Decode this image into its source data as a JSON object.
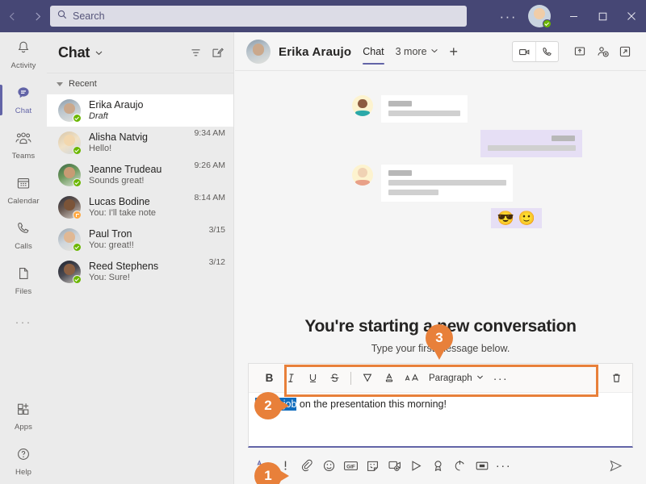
{
  "titlebar": {
    "back_icon": "chevron-left-icon",
    "forward_icon": "chevron-right-icon",
    "search_placeholder": "Search",
    "search_value": "",
    "settings_ellipsis": "···",
    "minimize_label": "—",
    "maximize_label": "☐",
    "close_label": "✕"
  },
  "rail": {
    "items": [
      {
        "label": "Activity",
        "icon": "bell-icon",
        "active": false
      },
      {
        "label": "Chat",
        "icon": "chat-bubble-icon",
        "active": true
      },
      {
        "label": "Teams",
        "icon": "people-icon",
        "active": false
      },
      {
        "label": "Calendar",
        "icon": "calendar-icon",
        "active": false
      },
      {
        "label": "Calls",
        "icon": "phone-icon",
        "active": false
      },
      {
        "label": "Files",
        "icon": "file-icon",
        "active": false
      }
    ],
    "more_label": "···",
    "bottom": [
      {
        "label": "Apps",
        "icon": "apps-grid-icon"
      },
      {
        "label": "Help",
        "icon": "question-circle-icon"
      }
    ]
  },
  "chatlist": {
    "title": "Chat",
    "caret_icon": "chevron-down-icon",
    "filter_icon": "filter-icon",
    "compose_icon": "new-chat-icon",
    "section_label": "Recent",
    "items": [
      {
        "name": "Erika Araujo",
        "preview": "Draft",
        "time": "",
        "selected": true,
        "draft": true,
        "presence": "available",
        "face": "f1"
      },
      {
        "name": "Alisha Natvig",
        "preview": "Hello!",
        "time": "9:34 AM",
        "selected": false,
        "draft": false,
        "presence": "available",
        "face": "f2"
      },
      {
        "name": "Jeanne Trudeau",
        "preview": "Sounds great!",
        "time": "9:26 AM",
        "selected": false,
        "draft": false,
        "presence": "available",
        "face": "f3"
      },
      {
        "name": "Lucas Bodine",
        "preview": "You: I'll take note",
        "time": "8:14 AM",
        "selected": false,
        "draft": false,
        "presence": "away",
        "face": "f4"
      },
      {
        "name": "Paul Tron",
        "preview": "You: great!!",
        "time": "3/15",
        "selected": false,
        "draft": false,
        "presence": "available",
        "face": "f5"
      },
      {
        "name": "Reed Stephens",
        "preview": "You: Sure!",
        "time": "3/12",
        "selected": false,
        "draft": false,
        "presence": "available",
        "face": "f6"
      }
    ]
  },
  "chat_header": {
    "contact_name": "Erika Araujo",
    "tabs": [
      {
        "label": "Chat",
        "active": true
      }
    ],
    "more_tabs_label": "3 more",
    "more_caret_icon": "chevron-down-icon",
    "add_tab_label": "+",
    "actions": [
      {
        "name": "video-call-icon"
      },
      {
        "name": "audio-call-icon"
      },
      {
        "name": "share-screen-icon"
      },
      {
        "name": "add-people-icon"
      },
      {
        "name": "popout-icon"
      }
    ]
  },
  "conversation": {
    "empty_title": "You're starting a new conversation",
    "empty_subtitle": "Type your first message below.",
    "reaction_emojis": [
      "😎",
      "🙂"
    ]
  },
  "compose": {
    "format_buttons": [
      {
        "name": "bold-button",
        "label": "B"
      },
      {
        "name": "italic-button",
        "label": "I"
      },
      {
        "name": "underline-button",
        "label": "U"
      },
      {
        "name": "strikethrough-button",
        "label": "S"
      },
      {
        "name": "highlight-color-button",
        "label": ""
      },
      {
        "name": "font-color-button",
        "label": "A"
      },
      {
        "name": "font-size-button",
        "label": "AA"
      }
    ],
    "paragraph_label": "Paragraph",
    "paragraph_caret_icon": "chevron-down-icon",
    "more_format_label": "···",
    "discard_icon": "trash-icon",
    "message_selected_text": "Great job",
    "message_rest_text": " on the presentation this morning!"
  },
  "action_bar": {
    "buttons": [
      {
        "name": "format-button",
        "accent": true
      },
      {
        "name": "importance-button",
        "accent": false
      },
      {
        "name": "attach-file-button",
        "accent": false
      },
      {
        "name": "emoji-button",
        "accent": false
      },
      {
        "name": "giphy-button",
        "accent": false
      },
      {
        "name": "sticker-button",
        "accent": false
      },
      {
        "name": "meet-now-button",
        "accent": false
      },
      {
        "name": "stream-button",
        "accent": false
      },
      {
        "name": "praise-button",
        "accent": false
      },
      {
        "name": "loop-button",
        "accent": false
      },
      {
        "name": "video-clip-button",
        "accent": false
      }
    ],
    "more_label": "···",
    "send_icon": "send-icon"
  },
  "callouts": [
    {
      "number": "1",
      "direction": "right"
    },
    {
      "number": "2",
      "direction": "right"
    },
    {
      "number": "3",
      "direction": "down"
    }
  ],
  "colors": {
    "titlebar": "#464775",
    "accent": "#6264a7",
    "callout": "#e8803a",
    "selection": "#0f6cbd",
    "presence_available": "#6bb700",
    "presence_away": "#ffaa44"
  }
}
